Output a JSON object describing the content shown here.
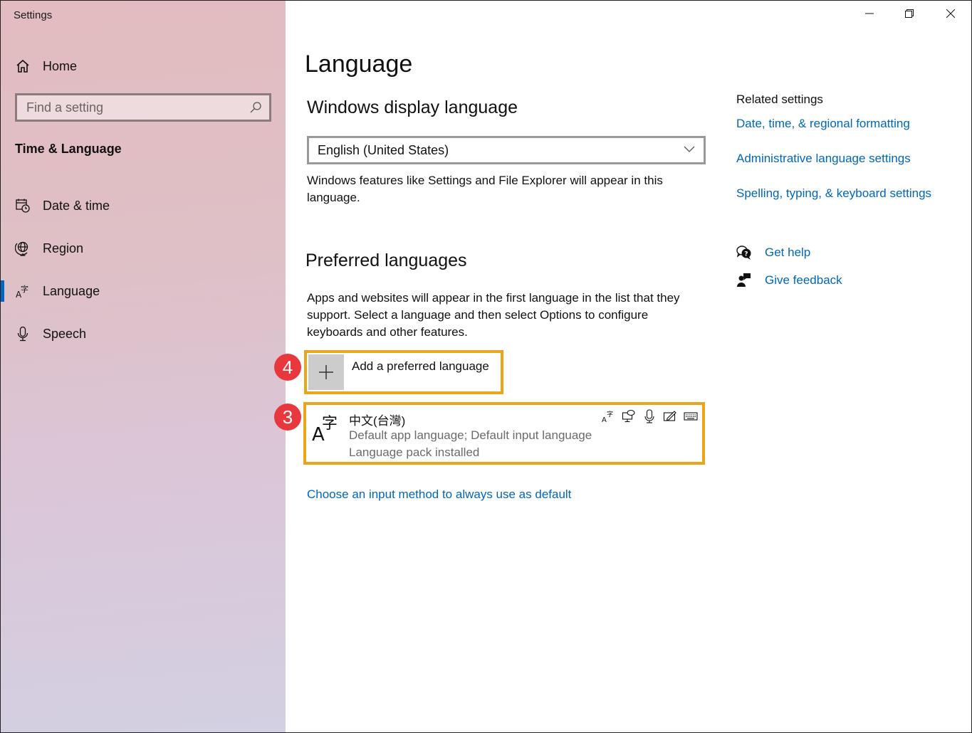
{
  "window": {
    "title": "Settings",
    "controls": {
      "minimize": "minimize-icon",
      "restore": "restore-icon",
      "close": "close-icon"
    }
  },
  "sidebar": {
    "home_label": "Home",
    "search_placeholder": "Find a setting",
    "search_value": "",
    "section_title": "Time & Language",
    "items": [
      {
        "label": "Date & time",
        "icon": "calendar-clock-icon",
        "active": false
      },
      {
        "label": "Region",
        "icon": "globe-icon",
        "active": false
      },
      {
        "label": "Language",
        "icon": "language-icon",
        "active": true
      },
      {
        "label": "Speech",
        "icon": "microphone-icon",
        "active": false
      }
    ],
    "accent_color": "#0066c4"
  },
  "main": {
    "page_title": "Language",
    "display_language": {
      "heading": "Windows display language",
      "selected": "English (United States)",
      "description": "Windows features like Settings and File Explorer will appear in this language."
    },
    "preferred": {
      "heading": "Preferred languages",
      "description": "Apps and websites will appear in the first language in the list that they support. Select a language and then select Options to configure keyboards and other features.",
      "add_label": "Add a preferred language",
      "languages": [
        {
          "name": "中文(台灣)",
          "line1": "Default app language; Default input language",
          "line2": "Language pack installed",
          "feature_icons": [
            "display-language-icon",
            "text-to-speech-icon",
            "speech-recognition-icon",
            "handwriting-icon",
            "keyboard-icon"
          ]
        }
      ]
    },
    "choose_input_link": "Choose an input method to always use as default",
    "annotations": [
      {
        "number": "4",
        "target": "add-preferred-language"
      },
      {
        "number": "3",
        "target": "language-item"
      }
    ],
    "highlight_color": "#eaa51a",
    "badge_color": "#e8383d"
  },
  "related": {
    "title": "Related settings",
    "links": [
      "Date, time, & regional formatting",
      "Administrative language settings",
      "Spelling, typing, & keyboard settings"
    ],
    "help": [
      {
        "label": "Get help",
        "icon": "help-chat-icon"
      },
      {
        "label": "Give feedback",
        "icon": "feedback-icon"
      }
    ],
    "link_color": "#0067b8"
  }
}
